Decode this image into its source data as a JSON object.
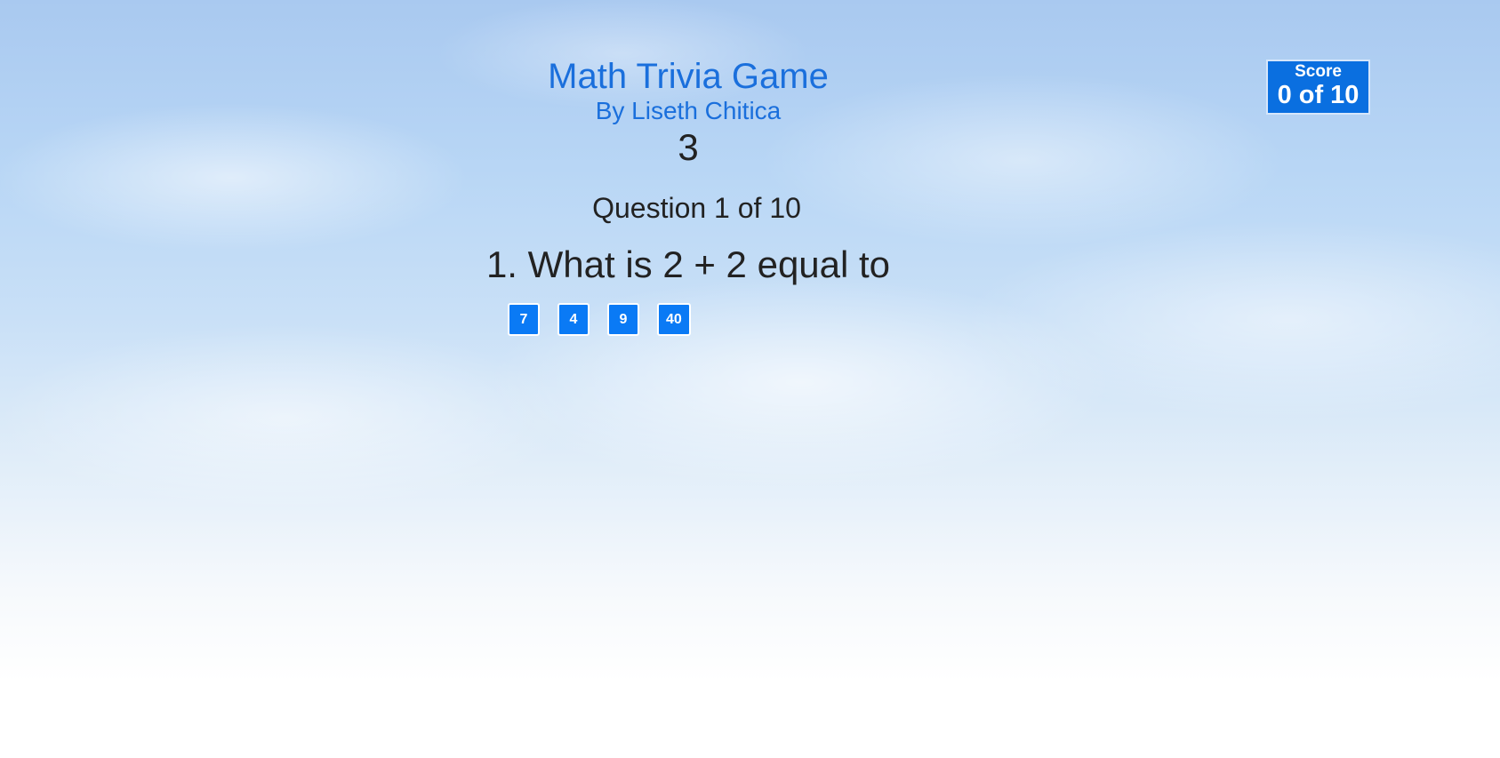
{
  "header": {
    "title": "Math Trivia Game",
    "subtitle": "By Liseth Chitica",
    "timer": "3"
  },
  "question": {
    "counter": "Question 1 of 10",
    "text": "1. What is 2 + 2 equal to"
  },
  "answers": [
    "7",
    "4",
    "9",
    "40"
  ],
  "score": {
    "label": "Score",
    "value": "0 of 10"
  },
  "colors": {
    "accent": "#1a6fdc",
    "button": "#0a7af5",
    "score_box": "#0a6fe0"
  }
}
